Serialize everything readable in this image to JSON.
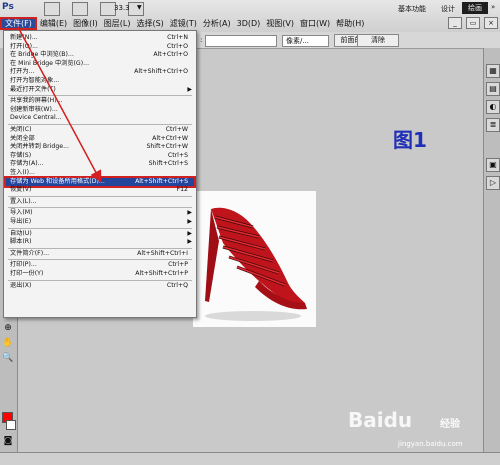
{
  "app": {
    "logo": "Ps",
    "zoom": "33.3"
  },
  "workspace": {
    "basic": "基本功能",
    "design": "设计",
    "paint": "绘画"
  },
  "menubar": [
    {
      "label": "文件(F)",
      "active": true
    },
    {
      "label": "编辑(E)"
    },
    {
      "label": "图像(I)"
    },
    {
      "label": "图层(L)"
    },
    {
      "label": "选择(S)"
    },
    {
      "label": "滤镜(T)"
    },
    {
      "label": "分析(A)"
    },
    {
      "label": "3D(D)"
    },
    {
      "label": "视图(V)"
    },
    {
      "label": "窗口(W)"
    },
    {
      "label": "帮助(H)"
    }
  ],
  "options": {
    "unit": "像素/...",
    "front_image": "前面的图像",
    "clear": "清除"
  },
  "file_menu": [
    {
      "label": "新建(N)...",
      "shortcut": "Ctrl+N"
    },
    {
      "label": "打开(O)...",
      "shortcut": "Ctrl+O"
    },
    {
      "label": "在 Bridge 中浏览(B)...",
      "shortcut": "Alt+Ctrl+O"
    },
    {
      "label": "在 Mini Bridge 中浏览(G)...",
      "shortcut": ""
    },
    {
      "label": "打开为...",
      "shortcut": "Alt+Shift+Ctrl+O"
    },
    {
      "label": "打开为智能对象...",
      "shortcut": ""
    },
    {
      "label": "最近打开文件(T)",
      "shortcut": "",
      "submenu": true
    },
    {
      "sep": true
    },
    {
      "label": "共享我的屏幕(H)...",
      "shortcut": ""
    },
    {
      "label": "创建新审核(W)...",
      "shortcut": ""
    },
    {
      "label": "Device Central...",
      "shortcut": ""
    },
    {
      "sep": true
    },
    {
      "label": "关闭(C)",
      "shortcut": "Ctrl+W"
    },
    {
      "label": "关闭全部",
      "shortcut": "Alt+Ctrl+W"
    },
    {
      "label": "关闭并转到 Bridge...",
      "shortcut": "Shift+Ctrl+W"
    },
    {
      "label": "存储(S)",
      "shortcut": "Ctrl+S"
    },
    {
      "label": "存储为(A)...",
      "shortcut": "Shift+Ctrl+S"
    },
    {
      "label": "签入(I)...",
      "shortcut": ""
    },
    {
      "label": "存储为 Web 和设备所用格式(D)...",
      "shortcut": "Alt+Shift+Ctrl+S",
      "highlighted": true
    },
    {
      "label": "恢复(V)",
      "shortcut": "F12"
    },
    {
      "sep": true
    },
    {
      "label": "置入(L)...",
      "shortcut": ""
    },
    {
      "sep": true
    },
    {
      "label": "导入(M)",
      "shortcut": "",
      "submenu": true
    },
    {
      "label": "导出(E)",
      "shortcut": "",
      "submenu": true
    },
    {
      "sep": true
    },
    {
      "label": "自动(U)",
      "shortcut": "",
      "submenu": true
    },
    {
      "label": "脚本(R)",
      "shortcut": "",
      "submenu": true
    },
    {
      "sep": true
    },
    {
      "label": "文件简介(F)...",
      "shortcut": "Alt+Shift+Ctrl+I"
    },
    {
      "sep": true
    },
    {
      "label": "打印(P)...",
      "shortcut": "Ctrl+P"
    },
    {
      "label": "打印一份(Y)",
      "shortcut": "Alt+Shift+Ctrl+P"
    },
    {
      "sep": true
    },
    {
      "label": "退出(X)",
      "shortcut": "Ctrl+Q"
    }
  ],
  "annotation": {
    "label": "图1"
  },
  "watermark": {
    "brand": "Baidu",
    "experience": "经验",
    "site": "jingyan.baidu.com"
  },
  "colors": {
    "foreground": "#ff0000",
    "background": "#ffffff",
    "highlight": "#24459c",
    "annotation": "#1f2fb8"
  }
}
